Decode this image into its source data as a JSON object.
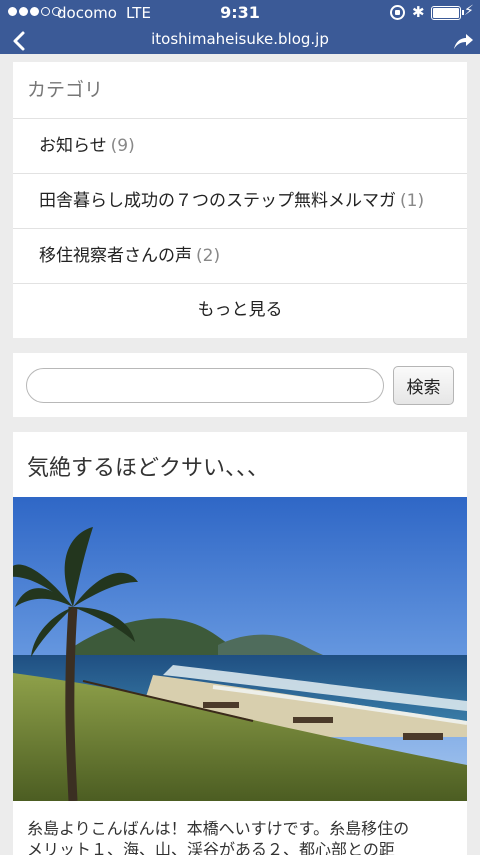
{
  "status_bar": {
    "carrier": "docomo",
    "network": "LTE",
    "time": "9:31",
    "signal_bars_filled": 3,
    "signal_bars_total": 5,
    "battery_level": 1.0
  },
  "browser": {
    "url": "itoshimaheisuke.blog.jp",
    "bar_color": "#3b5a97"
  },
  "categories": {
    "title": "カテゴリ",
    "items": [
      {
        "label": "お知らせ",
        "count": "(9)"
      },
      {
        "label": "田舎暮らし成功の７つのステップ無料メルマガ",
        "count": "(1)"
      },
      {
        "label": "移住視察者さんの声",
        "count": "(2)"
      }
    ],
    "more_label": "もっと見る"
  },
  "search": {
    "placeholder": "",
    "value": "",
    "button_label": "検索"
  },
  "post": {
    "title": "気絶するほどクサい、、、",
    "excerpt_line1": "糸島よりこんばんは！本橋へいすけです。糸島移住の",
    "excerpt_line2": "メリット１、海、山、渓谷がある２、都心部との距"
  }
}
